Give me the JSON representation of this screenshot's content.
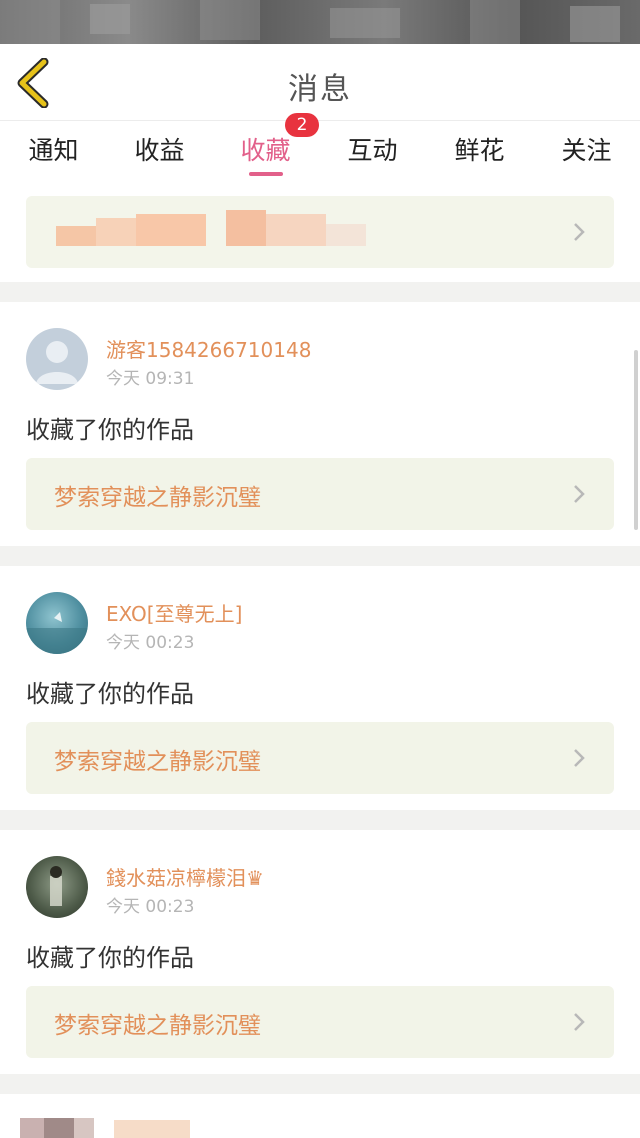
{
  "header": {
    "title": "消息",
    "back_icon": "chevron-left-icon",
    "back_color": "#e6c21a"
  },
  "tabs": [
    {
      "label": "通知",
      "active": false
    },
    {
      "label": "收益",
      "active": false
    },
    {
      "label": "收藏",
      "active": true,
      "badge": "2"
    },
    {
      "label": "互动",
      "active": false
    },
    {
      "label": "鲜花",
      "active": false
    },
    {
      "label": "关注",
      "active": false
    }
  ],
  "colors": {
    "accent": "#e2608a",
    "badge": "#e8333f",
    "username": "#e2905a",
    "work_bg": "#f2f4e8"
  },
  "notifications": [
    {
      "username": "游客1584266710148",
      "time": "今天 09:31",
      "message": "收藏了你的作品",
      "work_title": "梦索穿越之静影沉璧"
    },
    {
      "username": "EXO[至尊无上]",
      "time": "今天 00:23",
      "message": "收藏了你的作品",
      "work_title": "梦索穿越之静影沉璧"
    },
    {
      "username": "錢水菇凉檸檬泪♛",
      "time": "今天 00:23",
      "message": "收藏了你的作品",
      "work_title": "梦索穿越之静影沉璧"
    }
  ]
}
